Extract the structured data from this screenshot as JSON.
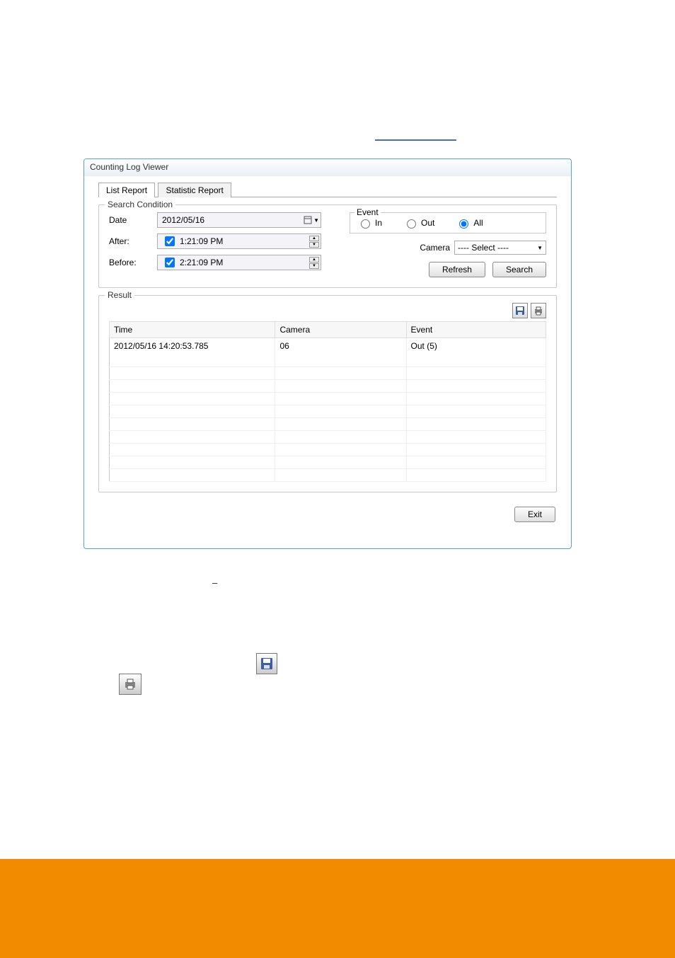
{
  "window": {
    "title": "Counting Log Viewer"
  },
  "tabs": {
    "list": "List Report",
    "statistic": "Statistic Report"
  },
  "search": {
    "legend": "Search Condition",
    "date_label": "Date",
    "date_value": "2012/05/16",
    "after_label": "After:",
    "after_value": "1:21:09 PM",
    "before_label": "Before:",
    "before_value": "2:21:09 PM",
    "event_legend": "Event",
    "event_in": "In",
    "event_out": "Out",
    "event_all": "All",
    "camera_label": "Camera",
    "camera_value": "---- Select ----",
    "refresh_btn": "Refresh",
    "search_btn": "Search"
  },
  "result": {
    "legend": "Result",
    "cols": {
      "time": "Time",
      "camera": "Camera",
      "event": "Event"
    },
    "rows": [
      {
        "time": "2012/05/16 14:20:53.785",
        "camera": "06",
        "event": "Out (5)"
      }
    ]
  },
  "exit_btn": "Exit",
  "body_text": {
    "dash": "–"
  }
}
